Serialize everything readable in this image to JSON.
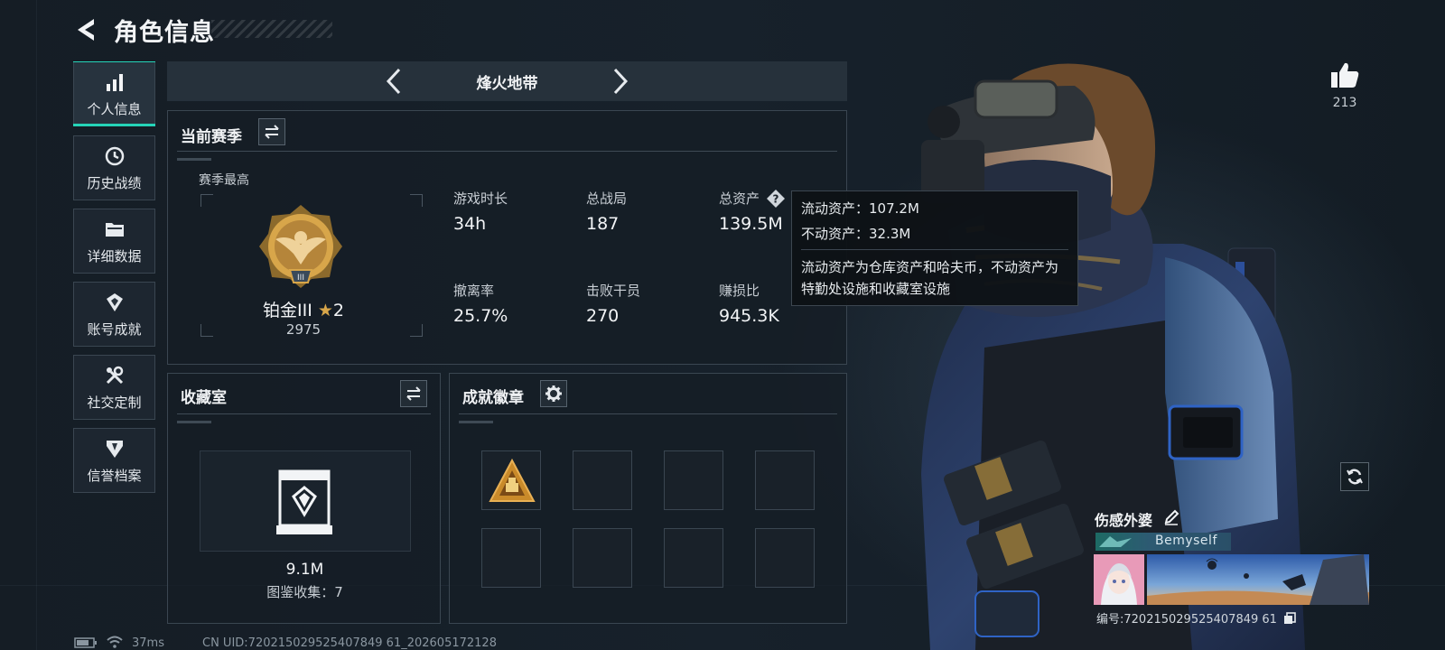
{
  "header": {
    "title": "角色信息",
    "back_icon": "back-arrow-icon"
  },
  "sidebar": {
    "items": [
      {
        "label": "个人信息",
        "icon": "bar-chart-icon",
        "active": true
      },
      {
        "label": "历史战绩",
        "icon": "history-clock-icon",
        "active": false
      },
      {
        "label": "详细数据",
        "icon": "folder-icon",
        "active": false
      },
      {
        "label": "账号成就",
        "icon": "achievement-icon",
        "active": false
      },
      {
        "label": "社交定制",
        "icon": "tools-icon",
        "active": false
      },
      {
        "label": "信誉档案",
        "icon": "shield-credit-icon",
        "active": false
      }
    ]
  },
  "mode": {
    "label": "烽火地带"
  },
  "season": {
    "title": "当前赛季",
    "best_label": "赛季最高",
    "rank_name": "铂金III",
    "rank_star": "★",
    "rank_stars": "2",
    "rank_score": "2975",
    "stats": [
      {
        "label": "游戏时长",
        "value": "34h"
      },
      {
        "label": "总战局",
        "value": "187"
      },
      {
        "label": "总资产",
        "value": "139.5M"
      },
      {
        "label": "撤离率",
        "value": "25.7%"
      },
      {
        "label": "击败干员",
        "value": "270"
      },
      {
        "label": "赚损比",
        "value": "945.3K"
      }
    ]
  },
  "tooltip": {
    "liquid": "流动资产：107.2M",
    "fixed": "不动资产：32.3M",
    "desc": "流动资产为仓库资产和哈夫币，不动资产为特勤处设施和收藏室设施"
  },
  "collection": {
    "title": "收藏室",
    "value": "9.1M",
    "count_text": "图鉴收集：7"
  },
  "achievements": {
    "title": "成就徽章",
    "slots": 8,
    "filled": 1
  },
  "likes": {
    "count": "213"
  },
  "player": {
    "name": "伤感外婆",
    "tag": "Bemyself",
    "id_text": "编号:720215029525407849 61"
  },
  "status": {
    "ping": "37ms",
    "uid": "CN UID:720215029525407849 61_202605172128"
  },
  "colors": {
    "accent": "#25d4b8",
    "gold": "#d8a64a"
  }
}
